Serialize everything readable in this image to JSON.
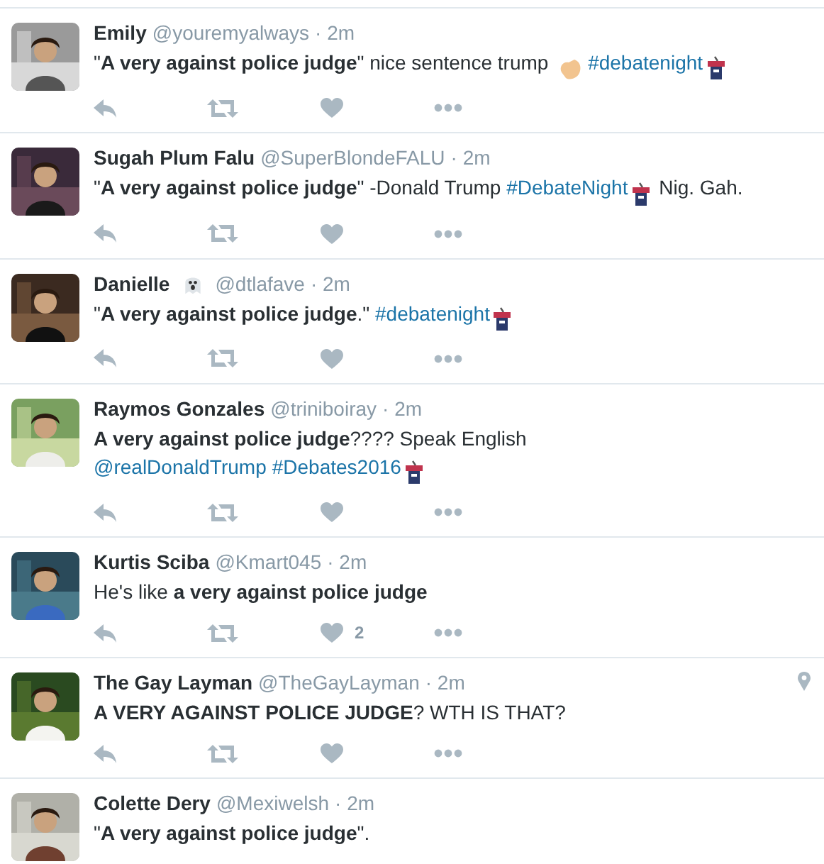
{
  "tweets": [
    {
      "name": "Emily",
      "handle": "@youremyalways",
      "time": "· 2m",
      "body": [
        {
          "kind": "text",
          "text": "\"**A very against police judge**\" nice sentence trump "
        },
        {
          "kind": "clap"
        },
        {
          "kind": "link",
          "text": "#debatenight"
        },
        {
          "kind": "podium"
        }
      ],
      "actions": true
    },
    {
      "name": "Sugah Plum Falu",
      "handle": "@SuperBlondeFALU",
      "time": "· 2m",
      "body": [
        {
          "kind": "text",
          "text": "\"**A very against police judge**\" -Donald Trump "
        },
        {
          "kind": "link",
          "text": "#DebateNight"
        },
        {
          "kind": "podium"
        },
        {
          "kind": "text",
          "text": " Nig. Gah."
        }
      ],
      "actions": true
    },
    {
      "name": "Danielle",
      "name_icon": {
        "kind": "ghost"
      },
      "handle": "@dtlafave",
      "time": "· 2m",
      "body": [
        {
          "kind": "text",
          "text": "\"**A very against police judge**.\" "
        },
        {
          "kind": "link",
          "text": "#debatenight"
        },
        {
          "kind": "podium"
        }
      ],
      "actions": true
    },
    {
      "name": "Raymos Gonzales",
      "handle": "@triniboiray",
      "time": "· 2m",
      "body": [
        {
          "kind": "text",
          "text": "**A very against police judge**???? Speak English "
        },
        {
          "kind": "link",
          "text": "@realDonaldTrump"
        },
        {
          "kind": "link",
          "text": "#Debates2016"
        },
        {
          "kind": "podium"
        }
      ],
      "actions": true
    },
    {
      "name": "Kurtis Sciba",
      "handle": "@Kmart045",
      "time": "· 2m",
      "body": [
        {
          "kind": "text",
          "text": "He's like **a very against police judge**"
        }
      ],
      "actions": true,
      "like_count": "2"
    },
    {
      "name": "The Gay Layman",
      "handle": "@TheGayLayman",
      "time": "· 2m",
      "location": true,
      "body": [
        {
          "kind": "text",
          "text": "**A VERY AGAINST POLICE JUDGE**? WTH IS THAT?"
        }
      ],
      "actions": true
    },
    {
      "name": "Colette Dery",
      "handle": "@Mexiwelsh",
      "time": "· 2m",
      "body": [
        {
          "kind": "text",
          "text": "\"**A very against police judge**\"."
        }
      ],
      "actions": false
    }
  ]
}
